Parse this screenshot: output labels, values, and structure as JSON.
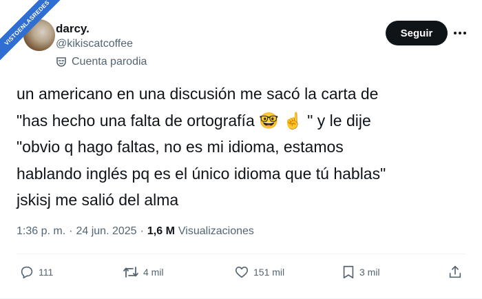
{
  "watermark": {
    "text": "VISTOENLASREDES"
  },
  "user": {
    "name": "darcy.",
    "handle": "@kikiscatcoffee",
    "parody_label": "Cuenta parodia"
  },
  "buttons": {
    "follow": "Seguir"
  },
  "tweet": {
    "line1": "un americano en una discusión me sacó la carta de",
    "line2_a": "\"has hecho una falta de ortografía ",
    "line2_emoji1": "🤓",
    "line2_emoji2": "☝️",
    "line2_b": " \" y le dije",
    "line3": "\"obvio q hago faltas, no es mi idioma, estamos",
    "line4": "hablando inglés pq es el único idioma que tú hablas\"",
    "line5": "jskisj me salió del alma"
  },
  "meta": {
    "time": "1:36 p. m.",
    "dot1": "·",
    "date": "24 jun. 2025",
    "dot2": "·",
    "views_count": "1,6 M",
    "views_label": "Visualizaciones"
  },
  "actions": {
    "replies": "111",
    "reposts": "4 mil",
    "likes": "151 mil",
    "bookmarks": "3 mil"
  },
  "icons": [
    "parody-mask-icon",
    "more-icon",
    "reply-icon",
    "repost-icon",
    "like-icon",
    "bookmark-icon",
    "share-icon"
  ],
  "colors": {
    "text": "#0f1419",
    "secondary": "#536471",
    "ribbon": "#2f6fd1",
    "button": "#0f1419"
  }
}
